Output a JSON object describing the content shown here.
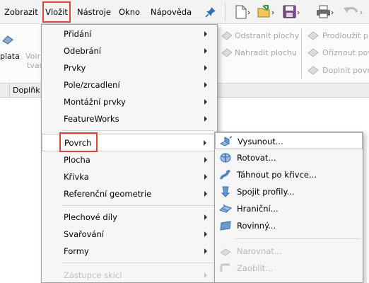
{
  "menubar": {
    "items": [
      "Zobrazit",
      "Vložit",
      "Nástroje",
      "Okno",
      "Nápověda"
    ],
    "active": "Vložit",
    "pin_icon": "pin-icon",
    "quick_access_icons": [
      "new-document-icon",
      "open-folder-icon",
      "save-icon",
      "print-icon",
      "undo-icon"
    ]
  },
  "ribbon": {
    "left_labels": [
      "plata",
      "Volr",
      "tvar"
    ],
    "col1": [
      "Odstranit plochy",
      "Nahradit plochu"
    ],
    "col2": [
      "Prodloužit p",
      "Oříznout pov",
      "Doplnit povr"
    ]
  },
  "tabs": [
    "",
    "Doplňk"
  ],
  "insert_menu": {
    "items": [
      {
        "label": "Přidání",
        "submenu": true
      },
      {
        "label": "Odebrání",
        "submenu": true
      },
      {
        "label": "Prvky",
        "submenu": true
      },
      {
        "label": "Pole/zrcadlení",
        "submenu": true
      },
      {
        "label": "Montážní prvky",
        "submenu": true
      },
      {
        "label": "FeatureWorks",
        "submenu": true
      },
      {
        "label": "Povrch",
        "submenu": true,
        "active": true
      },
      {
        "label": "Plocha",
        "submenu": true
      },
      {
        "label": "Křivka",
        "submenu": true
      },
      {
        "label": "Referenční geometrie",
        "submenu": true
      },
      {
        "label": "Plechové díly",
        "submenu": true
      },
      {
        "label": "Svařování",
        "submenu": true
      },
      {
        "label": "Formy",
        "submenu": true
      },
      {
        "label": "Zástupce skici",
        "submenu": true,
        "disabled": true
      }
    ]
  },
  "surface_submenu": {
    "items": [
      {
        "label": "Vysunout...",
        "icon": "extrude-surface-icon",
        "active": true
      },
      {
        "label": "Rotovat...",
        "icon": "revolve-surface-icon"
      },
      {
        "label": "Táhnout po křivce...",
        "icon": "sweep-surface-icon"
      },
      {
        "label": "Spojit profily...",
        "icon": "loft-surface-icon"
      },
      {
        "label": "Hraniční...",
        "icon": "boundary-surface-icon"
      },
      {
        "label": "Rovinný...",
        "icon": "planar-surface-icon"
      },
      {
        "label": "Narovnat...",
        "icon": "flatten-surface-icon",
        "disabled": true
      },
      {
        "label": "Zaoblit...",
        "icon": "fillet-icon",
        "disabled": true
      }
    ]
  },
  "colors": {
    "highlight_frame": "#d9483b",
    "icon_blue": "#2f6fb5",
    "menu_bg": "#f6f6f6",
    "disabled_text": "#b8b8b8"
  }
}
